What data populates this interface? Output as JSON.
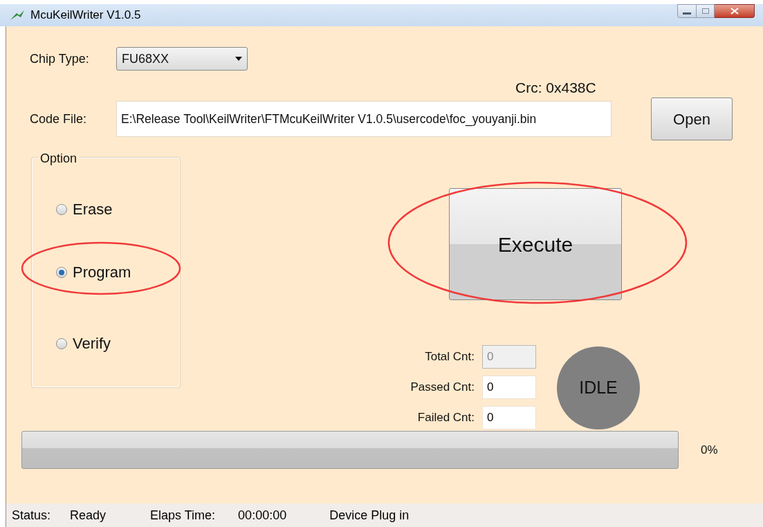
{
  "window": {
    "title": "McuKeilWriter V1.0.5"
  },
  "chip_type": {
    "label": "Chip Type:",
    "value": "FU68XX"
  },
  "crc": "Crc: 0x438C",
  "code_file": {
    "label": "Code File:",
    "value": "E:\\Release Tool\\KeilWriter\\FTMcuKeilWriter V1.0.5\\usercode\\foc_youyanji.bin"
  },
  "open_button": "Open",
  "option": {
    "title": "Option",
    "items": [
      {
        "label": "Erase",
        "selected": false
      },
      {
        "label": "Program",
        "selected": true
      },
      {
        "label": "Verify",
        "selected": false
      }
    ]
  },
  "execute_button": "Execute",
  "counters": [
    {
      "label": "Total Cnt:",
      "value": "0",
      "disabled": true
    },
    {
      "label": "Passed Cnt:",
      "value": "0",
      "disabled": false
    },
    {
      "label": "Failed Cnt:",
      "value": "0",
      "disabled": false
    }
  ],
  "state_indicator": "IDLE",
  "progress": {
    "level": 0,
    "reading": "0%"
  },
  "status_bar": [
    {
      "label": "Status:",
      "value": "Ready"
    },
    {
      "label": "Elaps Time:",
      "value": "00:00:00"
    },
    {
      "label": "Device Plug in"
    }
  ]
}
